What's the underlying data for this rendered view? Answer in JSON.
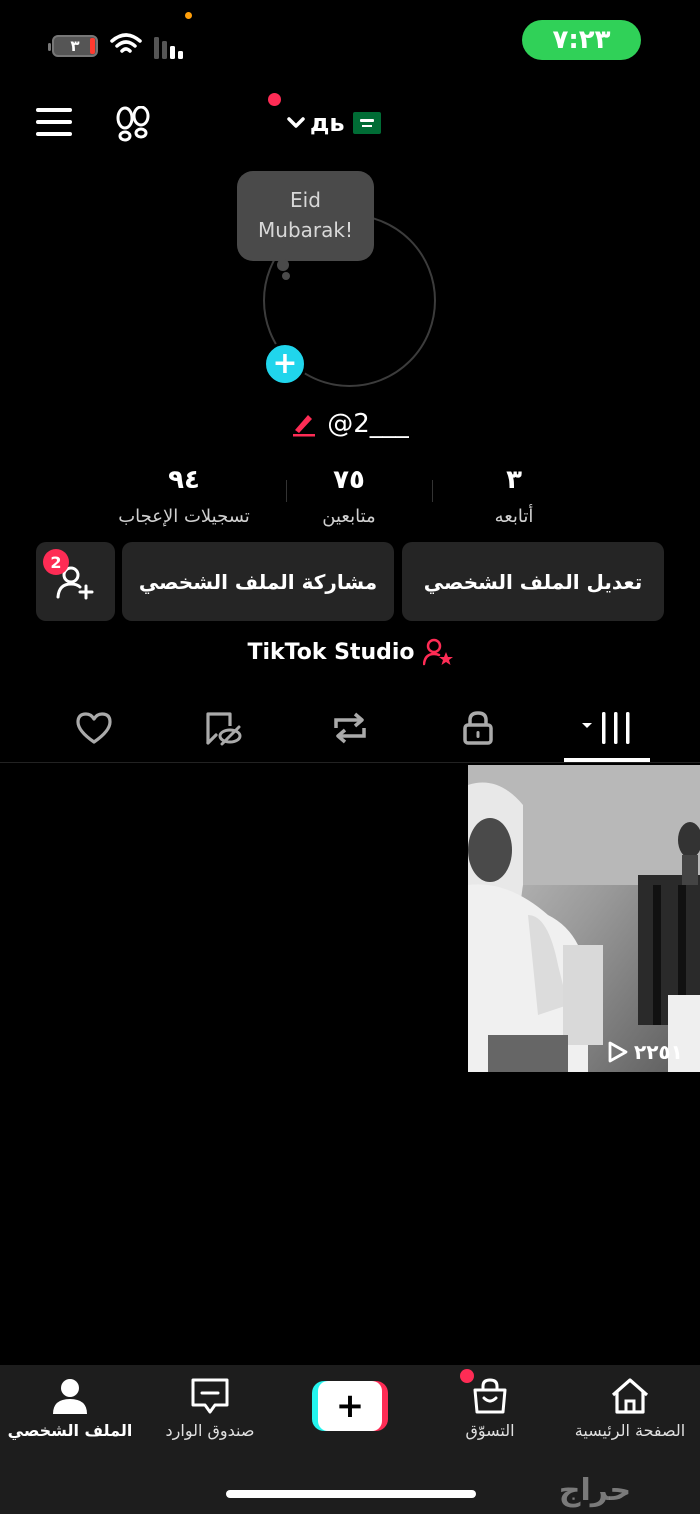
{
  "status_bar": {
    "time": "٧:٢٣",
    "battery": "٣"
  },
  "header": {
    "username": "дь"
  },
  "profile": {
    "bubble_text_1": "Eid",
    "bubble_text_2": "Mubarak!",
    "handle": "@2___"
  },
  "stats": {
    "following_count": "٣",
    "following_label": "أتابعه",
    "followers_count": "٧٥",
    "followers_label": "متابعين",
    "likes_count": "٩٤",
    "likes_label": "تسجيلات الإعجاب"
  },
  "actions": {
    "edit_profile": "تعديل الملف الشخصي",
    "share_profile": "مشاركة الملف الشخصي",
    "add_friends_badge": "2"
  },
  "studio": {
    "label": "TikTok Studio"
  },
  "video": {
    "views": "٢٢٥١"
  },
  "bottom_nav": {
    "home": "الصفحة الرئيسية",
    "shop": "التسوّق",
    "inbox": "صندوق الوارد",
    "profile": "الملف الشخصي"
  },
  "watermark": "حراج"
}
